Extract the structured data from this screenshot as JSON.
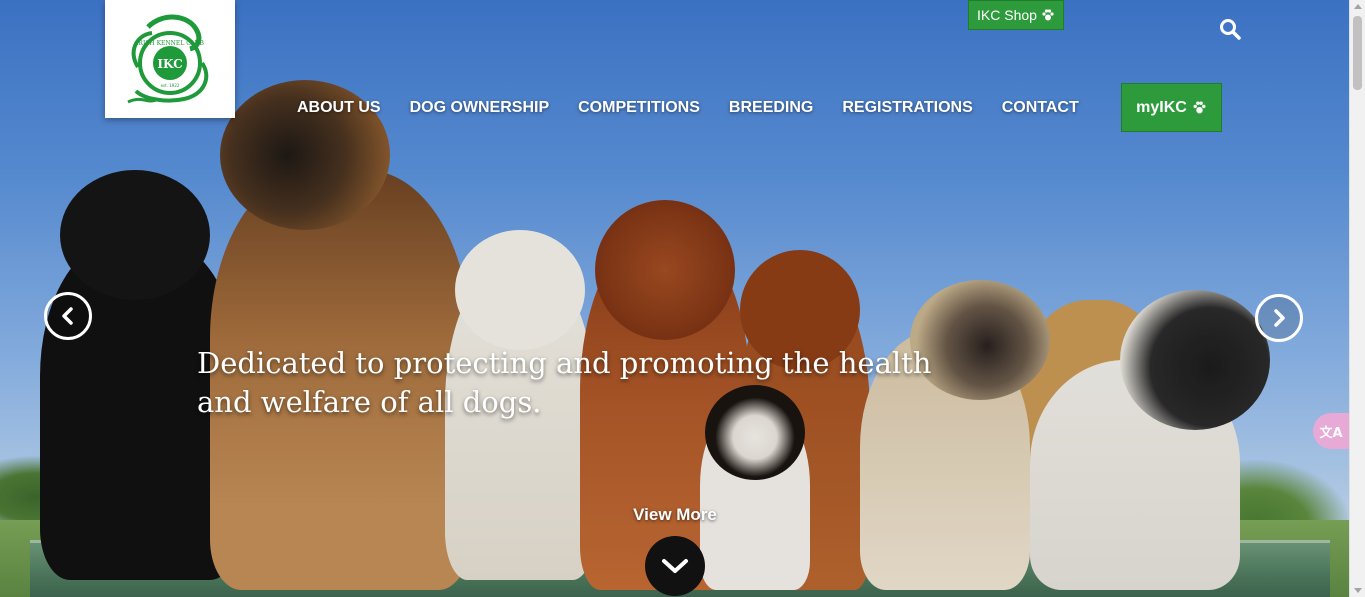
{
  "logo": {
    "text": "IKC",
    "arc_text": "IRISH KENNEL CLUB",
    "est": "est. 1922",
    "icon": "ikc-logo-icon"
  },
  "header": {
    "shop_label": "IKC Shop",
    "myikc_label": "myIKC",
    "paw_icon": "paw-icon",
    "search_icon": "search-icon"
  },
  "nav": {
    "items": [
      {
        "label": "ABOUT US"
      },
      {
        "label": "DOG OWNERSHIP"
      },
      {
        "label": "COMPETITIONS"
      },
      {
        "label": "BREEDING"
      },
      {
        "label": "REGISTRATIONS"
      },
      {
        "label": "CONTACT"
      }
    ]
  },
  "hero": {
    "headline_line1": "Dedicated to protecting and promoting the health",
    "headline_line2": "and welfare of all dogs.",
    "view_more": "View More"
  },
  "translate": {
    "icon": "translate-icon",
    "glyph": "文A"
  },
  "colors": {
    "brand_green": "#2d9b3c",
    "logo_green": "#1f9a3a"
  }
}
